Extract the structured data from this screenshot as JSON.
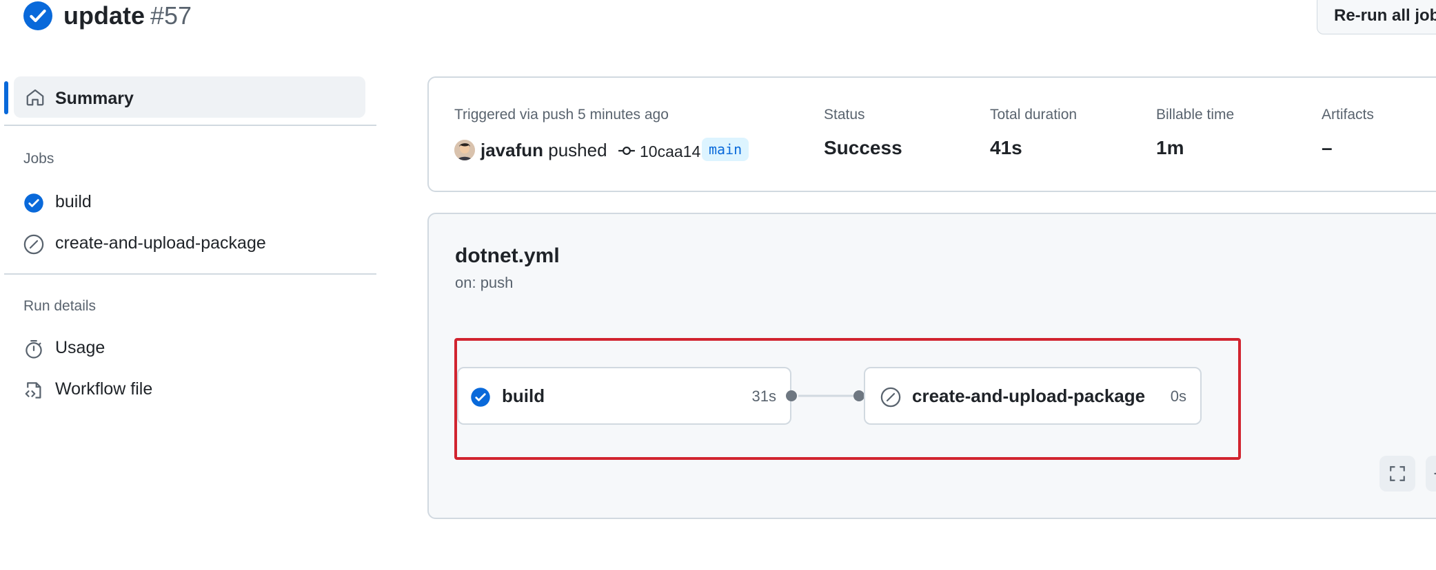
{
  "header": {
    "title": "update",
    "run_number": "#57",
    "rerun_label": "Re-run all jobs",
    "status_icon": "check-circle-fill-icon"
  },
  "sidebar": {
    "summary_label": "Summary",
    "jobs_heading": "Jobs",
    "jobs": [
      {
        "label": "build",
        "icon": "check-circle-fill-icon"
      },
      {
        "label": "create-and-upload-package",
        "icon": "skipped-icon"
      }
    ],
    "run_details_heading": "Run details",
    "run_details": [
      {
        "label": "Usage",
        "icon": "stopwatch-icon"
      },
      {
        "label": "Workflow file",
        "icon": "file-code-icon"
      }
    ]
  },
  "summary": {
    "trigger_text": "Triggered via push 5 minutes ago",
    "actor": "javafun",
    "action": "pushed",
    "commit": "10caa14",
    "branch": "main",
    "status_label": "Status",
    "status_value": "Success",
    "duration_label": "Total duration",
    "duration_value": "41s",
    "billable_label": "Billable time",
    "billable_value": "1m",
    "artifacts_label": "Artifacts",
    "artifacts_value": "–"
  },
  "workflow": {
    "file": "dotnet.yml",
    "trigger": "on: push",
    "jobs": [
      {
        "name": "build",
        "duration": "31s",
        "status": "success"
      },
      {
        "name": "create-and-upload-package",
        "duration": "0s",
        "status": "skipped"
      }
    ]
  },
  "colors": {
    "accent": "#0969da",
    "highlight": "#d1242f",
    "success": "#0969da",
    "muted": "#59636e"
  }
}
